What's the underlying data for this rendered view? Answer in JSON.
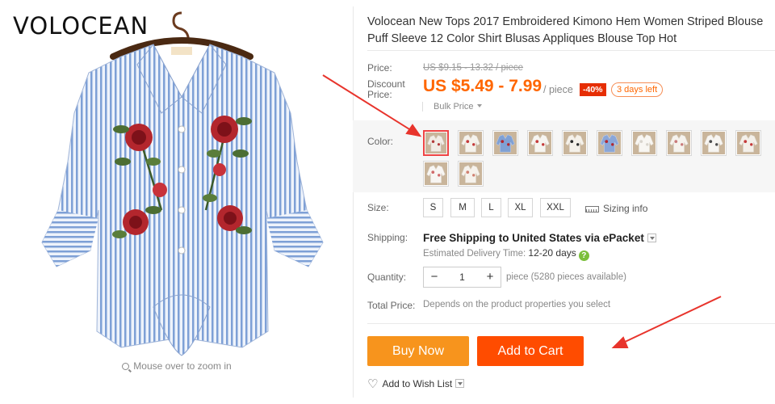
{
  "brand": "VOLOCEAN",
  "zoom_hint": "Mouse over to zoom in",
  "title": "Volocean New Tops 2017 Embroidered Kimono Hem Women Striped Blouse Puff Sleeve 12 Color Shirt Blusas Appliques Blouse Top Hot",
  "price": {
    "label": "Price:",
    "original": "US $9.15 - 13.32 / piece",
    "discount_label_line1": "Discount",
    "discount_label_line2": "Price:",
    "discounted": "US $5.49 - 7.99",
    "per_piece": "/ piece",
    "discount_badge": "-40%",
    "time_left": "3 days left",
    "bulk_price": "Bulk Price"
  },
  "color": {
    "label": "Color:",
    "swatches": [
      "Color 1",
      "Color 2",
      "Color 3",
      "Color 4",
      "Color 5",
      "Color 6",
      "Color 7",
      "Color 8",
      "Color 9",
      "Color 10",
      "Color 11",
      "Color 12"
    ]
  },
  "size": {
    "label": "Size:",
    "options": [
      "S",
      "M",
      "L",
      "XL",
      "XXL"
    ],
    "sizing_info": "Sizing info"
  },
  "shipping": {
    "label": "Shipping:",
    "main": "Free Shipping to United States via ePacket",
    "estimate_label": "Estimated Delivery Time:",
    "estimate_days": "12-20 days",
    "help": "?"
  },
  "quantity": {
    "label": "Quantity:",
    "value": "1",
    "minus": "−",
    "plus": "+",
    "available": "piece (5280 pieces available)"
  },
  "total": {
    "label": "Total Price:",
    "value": "Depends on the product properties you select"
  },
  "actions": {
    "buy_now": "Buy Now",
    "add_to_cart": "Add to Cart",
    "wish_list": "Add to Wish List"
  },
  "colors": {
    "price_orange": "#ff6600",
    "buy_now_bg": "#f7941d",
    "add_to_cart_bg": "#ff4c00",
    "discount_badge_bg": "#e62e04",
    "arrow_red": "#e8342c"
  }
}
